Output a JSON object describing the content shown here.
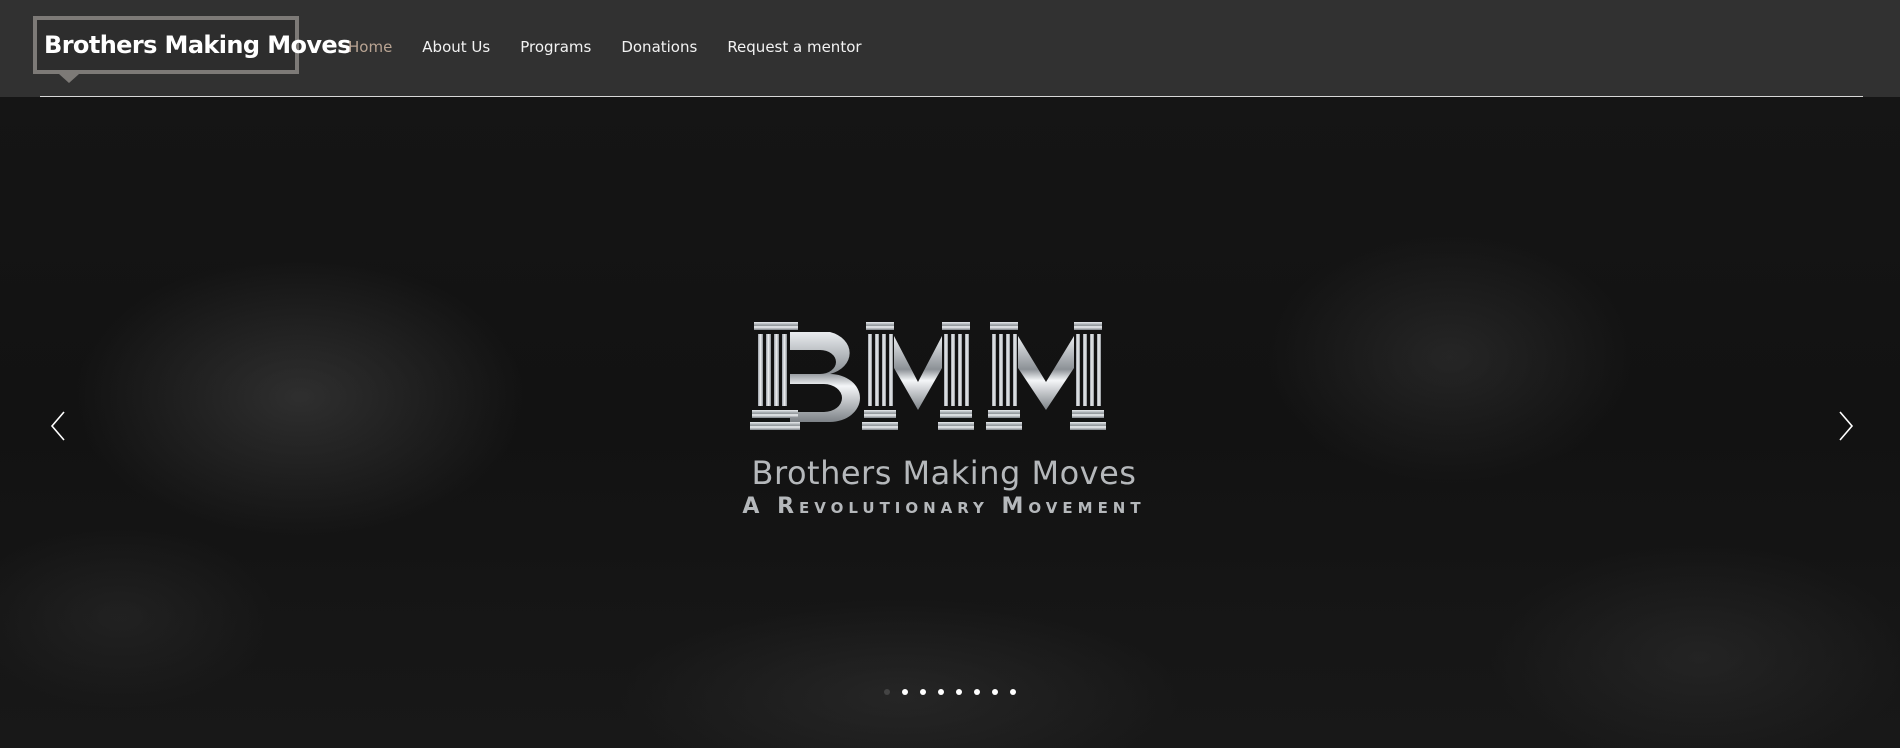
{
  "site": {
    "title": "Brothers Making Moves"
  },
  "nav": {
    "items": [
      {
        "label": "Home",
        "active": true
      },
      {
        "label": "About Us",
        "active": false
      },
      {
        "label": "Programs",
        "active": false
      },
      {
        "label": "Donations",
        "active": false
      },
      {
        "label": "Request a mentor",
        "active": false
      }
    ]
  },
  "hero": {
    "logo_letters": "BMM",
    "logo_line1": "Brothers Making Moves",
    "logo_line2": "A Revolutionary Movement",
    "prev_icon": "chevron-left-icon",
    "next_icon": "chevron-right-icon",
    "slide_count": 8,
    "active_slide": 1
  },
  "colors": {
    "header_bg": "#313131",
    "logo_border": "#7d7a77",
    "nav_active": "#b9a493",
    "nav_text": "#f2f2f2",
    "hero_bg": "#151515"
  }
}
